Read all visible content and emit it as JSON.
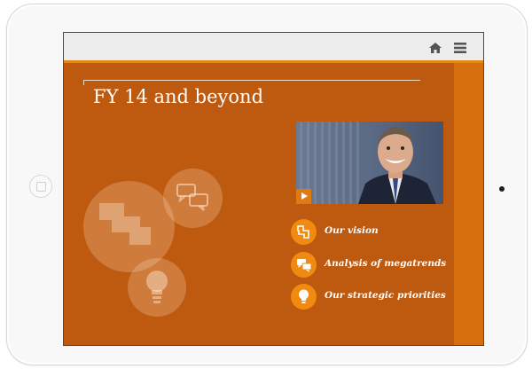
{
  "page": {
    "title": "FY 14 and beyond"
  },
  "toolbar": {
    "home_icon": "home-icon",
    "menu_icon": "menu-icon"
  },
  "video": {
    "play_icon": "play-icon"
  },
  "links": [
    {
      "label": "Our vision",
      "icon": "vision-icon"
    },
    {
      "label": "Analysis of megatrends",
      "icon": "chat-bubbles-icon"
    },
    {
      "label": "Our strategic priorities",
      "icon": "lightbulb-icon"
    }
  ],
  "colors": {
    "background": "#bd5a0f",
    "accent": "#e28a14",
    "right_band": "#d86f0e",
    "link_circle": "#f08a10",
    "topbar": "#ededed"
  }
}
